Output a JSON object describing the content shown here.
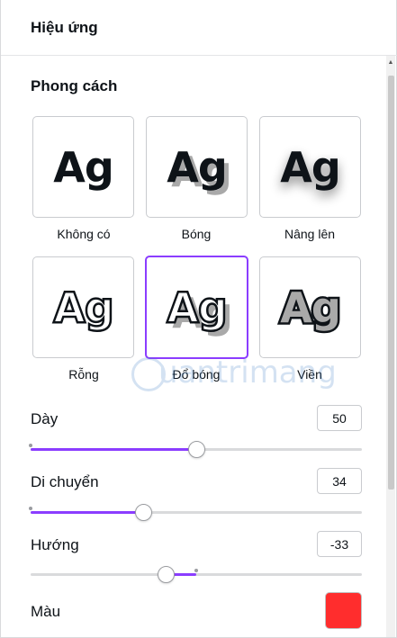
{
  "header": {
    "title": "Hiệu ứng"
  },
  "style_section": {
    "title": "Phong cách"
  },
  "styles": [
    {
      "id": "none",
      "preview": "Ag",
      "label": "Không có",
      "selected": false
    },
    {
      "id": "shadow",
      "preview": "Ag",
      "label": "Bóng",
      "selected": false
    },
    {
      "id": "lift",
      "preview": "Ag",
      "label": "Nâng lên",
      "selected": false
    },
    {
      "id": "hollow",
      "preview": "Ag",
      "label": "Rỗng",
      "selected": false
    },
    {
      "id": "splice",
      "preview": "Ag",
      "label": "Đổ bóng",
      "selected": true
    },
    {
      "id": "echo",
      "preview": "Ag",
      "label": "Viền",
      "selected": false
    }
  ],
  "watermark": {
    "text": "uantrimang"
  },
  "sliders": [
    {
      "label": "Dày",
      "value": "50",
      "min": 0,
      "max": 100,
      "number": 50
    },
    {
      "label": "Di chuyển",
      "value": "34",
      "min": 0,
      "max": 100,
      "number": 34
    },
    {
      "label": "Hướng",
      "value": "-33",
      "min": -180,
      "max": 180,
      "number": -33
    }
  ],
  "color": {
    "label": "Màu",
    "value": "#ff2d2d"
  },
  "accent_color": "#8b3dff"
}
